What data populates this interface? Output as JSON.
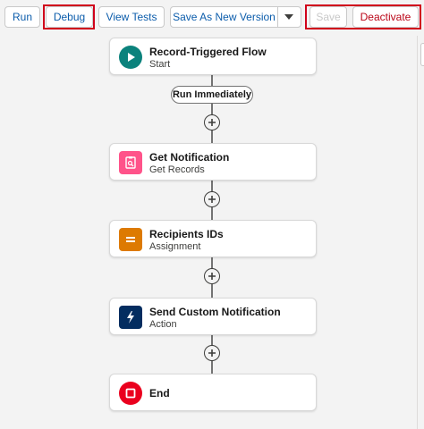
{
  "toolbar": {
    "run_label": "Run",
    "debug_label": "Debug",
    "view_tests_label": "View Tests",
    "save_as_new_version_label": "Save As New Version",
    "save_label": "Save",
    "deactivate_label": "Deactivate"
  },
  "flow": {
    "start": {
      "title": "Record-Triggered Flow",
      "subtitle": "Start",
      "color": "#0b827c"
    },
    "run_immediately": "Run Immediately",
    "nodes": [
      {
        "title": "Get Notification",
        "subtitle": "Get Records",
        "color": "#e3066a",
        "icon": "get-records-icon"
      },
      {
        "title": "Recipients IDs",
        "subtitle": "Assignment",
        "color": "#dd7a01",
        "icon": "assignment-icon"
      },
      {
        "title": "Send Custom Notification",
        "subtitle": "Action",
        "color": "#032d60",
        "icon": "lightning-icon"
      }
    ],
    "end": {
      "title": "End",
      "color": "#ea001e"
    }
  },
  "colors": {
    "highlight": "#d0021b",
    "brand_link": "#0b5cab",
    "deactivate": "#ba0517"
  }
}
